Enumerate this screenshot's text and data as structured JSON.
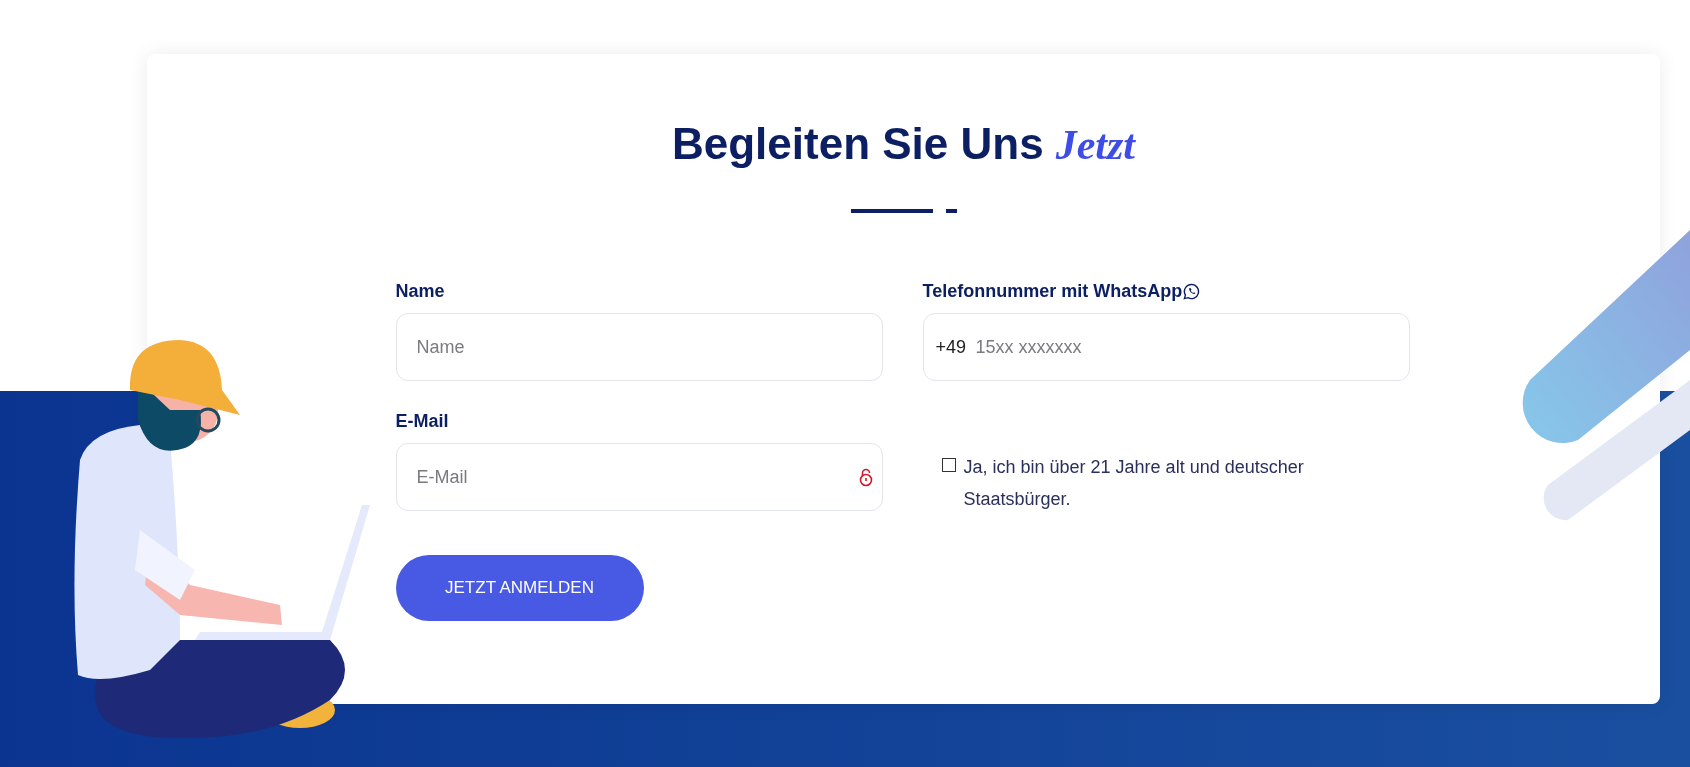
{
  "heading": {
    "text": "Begleiten Sie Uns",
    "accent": "Jetzt"
  },
  "fields": [
    {
      "kind": "text",
      "label": "Name",
      "placeholder": "Name"
    },
    {
      "kind": "phone",
      "label": "Telefonnummer mit WhatsApp",
      "prefix": "+49",
      "placeholder": "15xx xxxxxxx"
    },
    {
      "kind": "email",
      "label": "E-Mail",
      "placeholder": "E-Mail"
    },
    {
      "kind": "checkbox",
      "label": "Ja, ich bin über 21 Jahre alt und deutscher Staatsbürger.",
      "checked": false
    }
  ],
  "submit": "JETZT ANMELDEN"
}
